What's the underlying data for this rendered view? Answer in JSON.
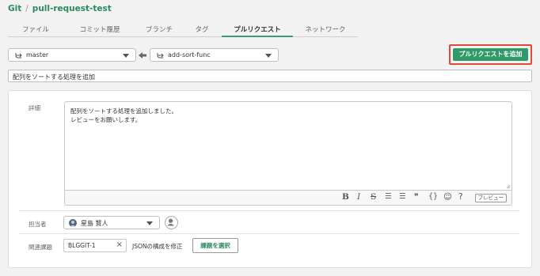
{
  "breadcrumb": {
    "root": "Git",
    "separator": "/",
    "repo": "pull-request-test"
  },
  "tabs": [
    "ファイル",
    "コミット履歴",
    "ブランチ",
    "タグ",
    "プルリクエスト",
    "ネットワーク"
  ],
  "active_tab": "プルリクエスト",
  "branches": {
    "base": "master",
    "compare": "add-sort-func"
  },
  "add_button_label": "プルリクエストを追加",
  "pr_title_value": "配列をソートする処理を追加",
  "description": {
    "label": "詳細",
    "lines": [
      "配列をソートする処理を追加しました。",
      "レビューをお願いします。"
    ]
  },
  "toolbar": {
    "bold": "B",
    "italic": "I",
    "strike": "S",
    "bullet_list": "☰",
    "numbered_list": "☰",
    "quote": "❞",
    "code": "{}",
    "emoji": "☺",
    "help": "?",
    "preview_label": "プレビュー"
  },
  "assignee": {
    "label": "担当者",
    "name": "星島 賢人"
  },
  "related_issue": {
    "label": "関連課題",
    "key": "BLGGIT-1",
    "clear": "×",
    "title": "JSONの構成を修正",
    "select_label": "課題を選択"
  },
  "colors": {
    "accent": "#2f9a67",
    "highlight_border": "#e04a3a",
    "link": "#2a8a5f"
  }
}
